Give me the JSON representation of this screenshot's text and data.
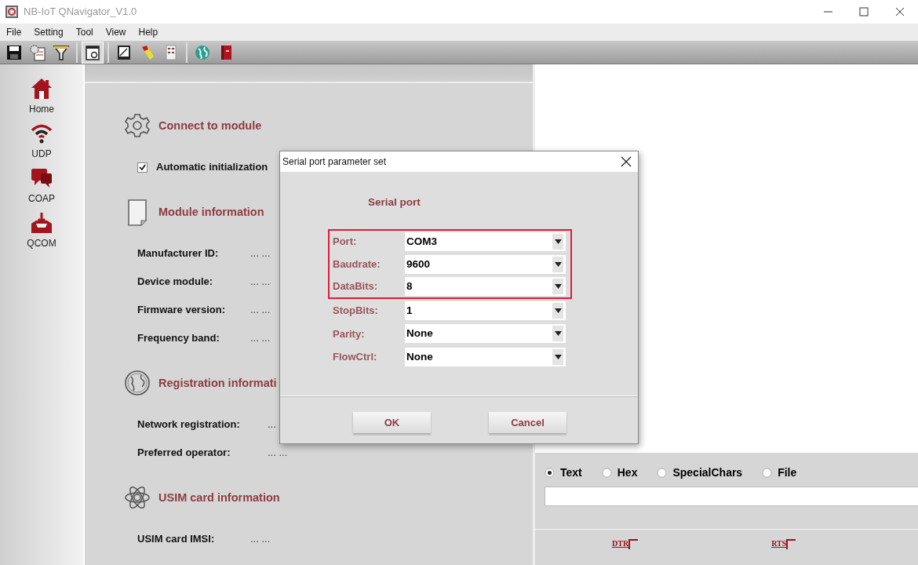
{
  "window": {
    "title": "NB-IoT QNavigator_V1.0"
  },
  "menu": [
    "File",
    "Setting",
    "Tool",
    "View",
    "Help"
  ],
  "toolbar": [
    {
      "selected": false
    },
    {
      "selected": false
    },
    {
      "selected": false
    },
    {
      "selected": true
    },
    {
      "selected": false
    },
    {
      "selected": false
    },
    {
      "selected": false
    },
    {
      "selected": false
    },
    {
      "selected": false
    }
  ],
  "sidebar": {
    "items": [
      {
        "label": "Home"
      },
      {
        "label": "UDP"
      },
      {
        "label": "COAP"
      },
      {
        "label": "QCOM"
      }
    ]
  },
  "main": {
    "sections": [
      {
        "title": "Connect to module",
        "rows": [
          {
            "kind": "checkbox",
            "label": "Automatic initialization",
            "checked": true
          }
        ]
      },
      {
        "title": "Module information",
        "rows": [
          {
            "kind": "field",
            "label": "Manufacturer ID:",
            "value": "... ..."
          },
          {
            "kind": "field",
            "label": "Device module:",
            "value": "... ..."
          },
          {
            "kind": "field",
            "label": "Firmware version:",
            "value": "... ..."
          },
          {
            "kind": "field",
            "label": "Frequency band:",
            "value": "... ..."
          }
        ]
      },
      {
        "title": "Registration informati",
        "rows": [
          {
            "kind": "field",
            "label": "Network registration:",
            "value": "..."
          },
          {
            "kind": "field",
            "label": "Preferred operator:",
            "value": "... ..."
          }
        ]
      },
      {
        "title": "USIM card information",
        "rows": [
          {
            "kind": "field",
            "label": "USIM card IMSI:",
            "value": "... ..."
          }
        ]
      }
    ]
  },
  "send": {
    "modes": [
      {
        "label": "Text",
        "selected": true
      },
      {
        "label": "Hex",
        "selected": false
      },
      {
        "label": "SpecialChars",
        "selected": false
      },
      {
        "label": "File",
        "selected": false
      }
    ],
    "signals": [
      "DTR",
      "RTS"
    ]
  },
  "dialog": {
    "title": "Serial port parameter set",
    "heading": "Serial port",
    "fields": [
      {
        "label": "Port:",
        "value": "COM3",
        "highlighted": true
      },
      {
        "label": "Baudrate:",
        "value": "9600",
        "highlighted": true
      },
      {
        "label": "DataBits:",
        "value": "8",
        "highlighted": true
      },
      {
        "label": "StopBits:",
        "value": "1",
        "highlighted": false
      },
      {
        "label": "Parity:",
        "value": "None",
        "highlighted": false
      },
      {
        "label": "FlowCtrl:",
        "value": "None",
        "highlighted": false
      }
    ],
    "buttons": [
      "OK",
      "Cancel"
    ]
  }
}
